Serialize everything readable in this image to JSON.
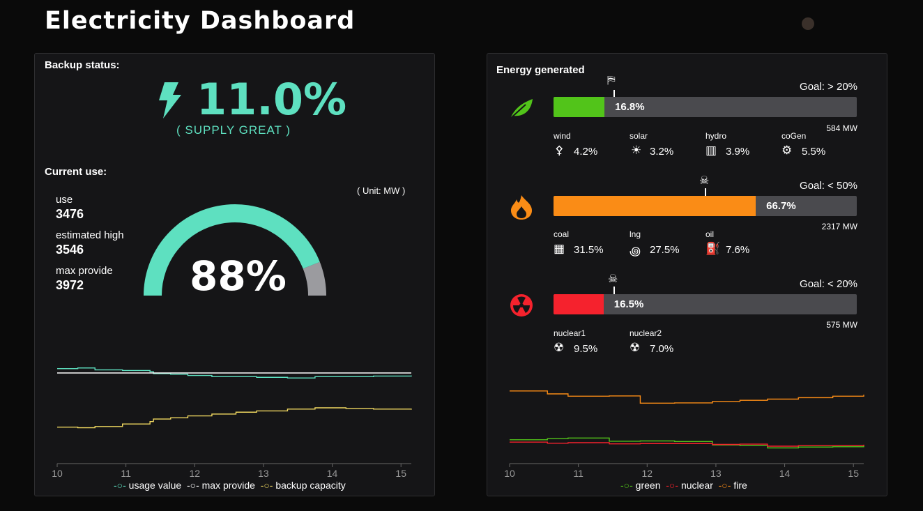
{
  "header": {
    "title": "Electricity Dashboard"
  },
  "backup": {
    "label": "Backup status:",
    "percent": "11.0%",
    "status": "( SUPPLY GREAT )"
  },
  "current_use": {
    "label": "Current use:",
    "unit": "( Unit: MW )",
    "stats": [
      {
        "label": "use",
        "value": "3476"
      },
      {
        "label": "estimated high",
        "value": "3546"
      },
      {
        "label": "max provide",
        "value": "3972"
      }
    ],
    "gauge_percent": "88%",
    "gauge_fraction": 0.88,
    "colors": {
      "gauge": "#5ee0c0",
      "gauge_rest": "#9b9b9f"
    }
  },
  "energy": {
    "label": "Energy generated",
    "categories": [
      {
        "icon": "leaf-icon",
        "color": "#52c41a",
        "percent": "16.8%",
        "fraction": 0.168,
        "goal": "Goal: > 20%",
        "mw": "584 MW",
        "marker_icon": "bandit-icon",
        "marker_fraction": 0.2,
        "sources": [
          {
            "name": "wind",
            "value": "4.2%",
            "icon": "wind-turbine-icon"
          },
          {
            "name": "solar",
            "value": "3.2%",
            "icon": "sun-icon"
          },
          {
            "name": "hydro",
            "value": "3.9%",
            "icon": "dam-icon"
          },
          {
            "name": "coGen",
            "value": "5.5%",
            "icon": "cogen-icon"
          }
        ]
      },
      {
        "icon": "fire-icon",
        "color": "#fa8c16",
        "percent": "66.7%",
        "fraction": 0.667,
        "goal": "Goal: < 50%",
        "mw": "2317 MW",
        "marker_icon": "pirate-icon",
        "marker_fraction": 0.5,
        "sources": [
          {
            "name": "coal",
            "value": "31.5%",
            "icon": "coal-cart-icon"
          },
          {
            "name": "lng",
            "value": "27.5%",
            "icon": "gas-icon"
          },
          {
            "name": "oil",
            "value": "7.6%",
            "icon": "oil-pump-icon"
          }
        ]
      },
      {
        "icon": "radiation-icon",
        "color": "#f5222d",
        "percent": "16.5%",
        "fraction": 0.165,
        "goal": "Goal: < 20%",
        "mw": "575 MW",
        "marker_icon": "pirate-icon",
        "marker_fraction": 0.2,
        "sources": [
          {
            "name": "nuclear1",
            "value": "9.5%",
            "icon": "nuclear-icon"
          },
          {
            "name": "nuclear2",
            "value": "7.0%",
            "icon": "nuclear-icon"
          }
        ]
      }
    ]
  },
  "chart_data": [
    {
      "type": "line",
      "title": "",
      "xlabel": "",
      "ylabel": "",
      "xlim": [
        10,
        15.15
      ],
      "ylim": [
        2800,
        4200
      ],
      "x_ticks": [
        "10",
        "11",
        "12",
        "13",
        "14",
        "15"
      ],
      "grid": false,
      "legend_position": "bottom",
      "x": [
        10,
        10.3,
        10.55,
        10.95,
        11.35,
        11.4,
        11.65,
        11.9,
        12.25,
        12.6,
        12.9,
        13.35,
        13.75,
        14.2,
        14.6,
        15.15
      ],
      "series": [
        {
          "name": "usage value",
          "color": "#5ee0c0",
          "values": [
            3990,
            4000,
            3970,
            3960,
            3940,
            3910,
            3900,
            3880,
            3860,
            3860,
            3850,
            3840,
            3860,
            3860,
            3870,
            3880
          ]
        },
        {
          "name": "max provide",
          "color": "#ffffff",
          "values": [
            3920,
            3920,
            3920,
            3920,
            3920,
            3920,
            3920,
            3920,
            3920,
            3920,
            3920,
            3920,
            3920,
            3920,
            3920,
            3920
          ]
        },
        {
          "name": "backup capacity",
          "color": "#f0d860",
          "values": [
            3050,
            3040,
            3060,
            3100,
            3140,
            3180,
            3200,
            3230,
            3260,
            3290,
            3310,
            3340,
            3360,
            3350,
            3340,
            3330
          ]
        }
      ]
    },
    {
      "type": "line",
      "title": "",
      "xlabel": "",
      "ylabel": "",
      "xlim": [
        10,
        15.15
      ],
      "ylim": [
        0,
        3000
      ],
      "x_ticks": [
        "10",
        "11",
        "12",
        "13",
        "14",
        "15"
      ],
      "grid": false,
      "legend_position": "bottom",
      "x": [
        10,
        10.55,
        10.85,
        11.45,
        11.9,
        12.4,
        12.95,
        13.35,
        13.75,
        14.2,
        14.7,
        15.15
      ],
      "series": [
        {
          "name": "green",
          "color": "#52c41a",
          "values": [
            700,
            740,
            760,
            650,
            660,
            640,
            520,
            500,
            420,
            450,
            460,
            520
          ]
        },
        {
          "name": "nuclear",
          "color": "#f5222d",
          "values": [
            620,
            580,
            600,
            560,
            570,
            570,
            540,
            550,
            480,
            500,
            500,
            530
          ]
        },
        {
          "name": "fire",
          "color": "#fa8c16",
          "values": [
            2380,
            2280,
            2200,
            2210,
            1960,
            1970,
            2020,
            2060,
            2100,
            2150,
            2200,
            2250
          ]
        }
      ]
    }
  ]
}
